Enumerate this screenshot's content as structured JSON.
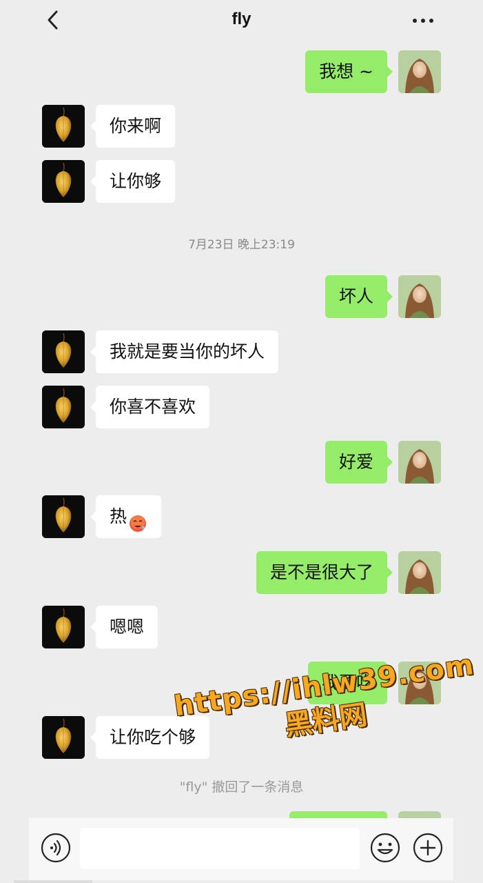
{
  "header": {
    "title": "fly",
    "back_icon": "back-chevron-icon",
    "more_icon": "more-dots-icon"
  },
  "messages": [
    {
      "from": "me",
      "text": "我想 ~"
    },
    {
      "from": "other",
      "text": "你来啊"
    },
    {
      "from": "other",
      "text": "让你够"
    },
    {
      "from": "me",
      "text": "坏人"
    },
    {
      "from": "other",
      "text": "我就是要当你的坏人"
    },
    {
      "from": "other",
      "text": "你喜不喜欢"
    },
    {
      "from": "me",
      "text": "好爱"
    },
    {
      "from": "other",
      "text": "热",
      "emoji": "hot-face-emoji"
    },
    {
      "from": "me",
      "text": "是不是很大了"
    },
    {
      "from": "other",
      "text": "嗯嗯"
    },
    {
      "from": "me",
      "text": "我要吃"
    },
    {
      "from": "other",
      "text": "让你吃个够"
    }
  ],
  "timestamp": "7月23日 晚上23:19",
  "recall_notice": "\"fly\" 撤回了一条消息",
  "watermark": {
    "line1": "https://ihlw39.com",
    "line2": "黑料网"
  },
  "input_bar": {
    "voice_icon": "voice-icon",
    "emoji_icon": "emoji-icon",
    "plus_icon": "plus-icon",
    "value": ""
  },
  "colors": {
    "background": "#ededed",
    "my_bubble": "#95ec69",
    "their_bubble": "#ffffff",
    "watermark": "#f6a820"
  }
}
